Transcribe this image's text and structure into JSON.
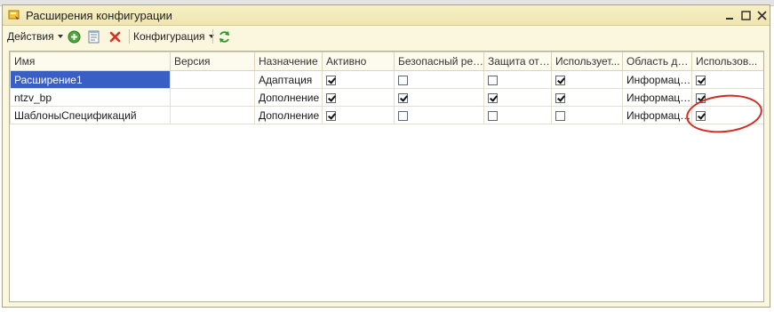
{
  "window": {
    "title": "Расширения конфигурации"
  },
  "toolbar": {
    "actions_label": "Действия",
    "config_label": "Конфигурация"
  },
  "table": {
    "columns": [
      "Имя",
      "Версия",
      "Назначение",
      "Активно",
      "Безопасный реж...",
      "Защита от о...",
      "Использует...",
      "Область дей...",
      "Использов..."
    ],
    "rows": [
      {
        "name": "Расширение1",
        "version": "",
        "purpose": "Адаптация",
        "active": true,
        "safe": false,
        "protect": false,
        "uses": true,
        "scope": "Информаци...",
        "used": true
      },
      {
        "name": "ntzv_bp",
        "version": "",
        "purpose": "Дополнение",
        "active": true,
        "safe": true,
        "protect": true,
        "uses": true,
        "scope": "Информаци...",
        "used": true
      },
      {
        "name": "ШаблоныСпецификаций",
        "version": "",
        "purpose": "Дополнение",
        "active": true,
        "safe": false,
        "protect": false,
        "uses": false,
        "scope": "Информаци...",
        "used": true
      }
    ]
  },
  "colors": {
    "selection": "#3a5fc4",
    "highlight_ellipse": "#d42a1f",
    "window_bg": "#fbf6de"
  }
}
